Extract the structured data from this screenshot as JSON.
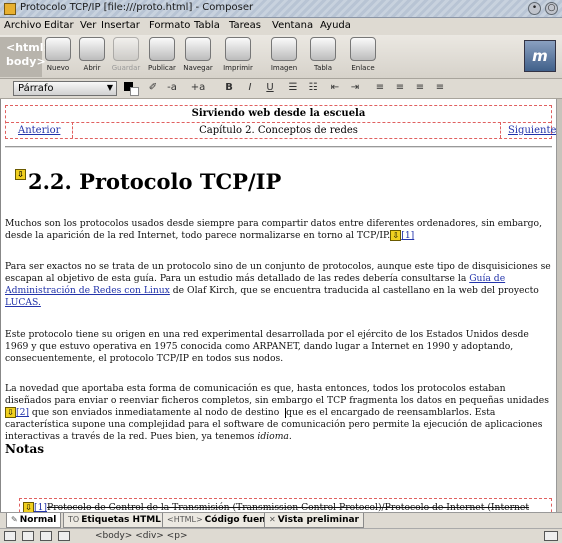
{
  "window": {
    "title": "Protocolo TCP/IP [file:///proto.html] - Composer"
  },
  "menubar": [
    "Archivo",
    "Editar",
    "Ver",
    "Insertar",
    "Formato",
    "Tabla",
    "Tareas",
    "Ventana",
    "Ayuda"
  ],
  "toolbar": {
    "mode_logo": "<html>\nbody>",
    "buttons": [
      {
        "label": "Nuevo",
        "enabled": true
      },
      {
        "label": "Abrir",
        "enabled": true
      },
      {
        "label": "Guardar",
        "enabled": false
      },
      {
        "label": "Publicar",
        "enabled": true
      },
      {
        "label": "Navegar",
        "enabled": true
      },
      {
        "label": "Imprimir",
        "enabled": true
      },
      {
        "label": "Imagen",
        "enabled": true
      },
      {
        "label": "Tabla",
        "enabled": true
      },
      {
        "label": "Enlace",
        "enabled": true
      }
    ],
    "throbber": "m"
  },
  "formatbar": {
    "paragraph_format": "Párrafo",
    "buttons": [
      "-a",
      "+a",
      "B",
      "I",
      "U"
    ]
  },
  "document": {
    "nav": {
      "title": "Sirviendo web desde la escuela",
      "prev": "Anterior",
      "chapter": "Capítulo 2. Conceptos de redes",
      "next": "Siguiente"
    },
    "heading": "2.2. Protocolo TCP/IP",
    "p1": {
      "text": "Muchos son los protocolos usados desde siempre para compartir datos entre diferentes ordenadores, sin embargo, desde la aparición de la red Internet, todo parece normalizarse en torno al TCP/IP.",
      "footnote": "[1]"
    },
    "p2": {
      "before": "Para ser exactos no se trata de un protocolo sino de un conjunto de protocolos, aunque este tipo de disquisiciones se escapan al objetivo de esta guía. Para un estudio más detallado de las redes debería consultarse la ",
      "link1": "Guía de Administración de Redes con Linux",
      "middle": " de Olaf Kirch, que se encuentra traducida al castellano en la web del proyecto ",
      "link2": "LUCAS."
    },
    "p3": "Este protocolo tiene su origen en una red experimental desarrollada por el ejército de los Estados Unidos desde 1969 y que estuvo operativa en 1975 conocida como ARPANET, dando lugar a Internet en 1990 y adoptando, consecuentemente, el protocolo TCP/IP en todos sus nodos.",
    "p4": {
      "before": "La novedad que aportaba esta forma de comunicación es que, hasta entonces, todos los protocolos estaban diseñados para enviar o reenviar ficheros completos, sin embargo el TCP fragmenta los datos en pequeñas unidades",
      "footnote": "[2]",
      "after_footnote": " que son enviados inmediatamente al nodo de destino ",
      "after_caret": "que es el encargado de reensamblarlos. Esta característica supone una complejidad para el software de comunicación pero permite la ejecución de aplicaciones interactivas a través de la red. Pues bien, ya tenemos ",
      "em": "idioma",
      "end": "."
    },
    "notes_heading": "Notas",
    "note1": {
      "marker": "[1]",
      "text": "Protocolo de Control de la Transmisión (Transmission Control Protocol)/Protocolo de Internet (Internet"
    }
  },
  "mode_tabs": [
    {
      "label": "Normal",
      "icon": "pencil-icon",
      "active": true
    },
    {
      "label": "Etiquetas HTML",
      "icon": "tags-icon",
      "active": false
    },
    {
      "label": "Código fuente",
      "icon": "html-icon",
      "active": false
    },
    {
      "label": "Vista preliminar",
      "icon": "preview-icon",
      "active": false
    }
  ],
  "mode_tab_icons": {
    "normal": "✎",
    "tags": "TO",
    "source": "<HTML>",
    "preview": "✕"
  },
  "statusbar": {
    "breadcrumb": "<body> <div> <p>"
  }
}
